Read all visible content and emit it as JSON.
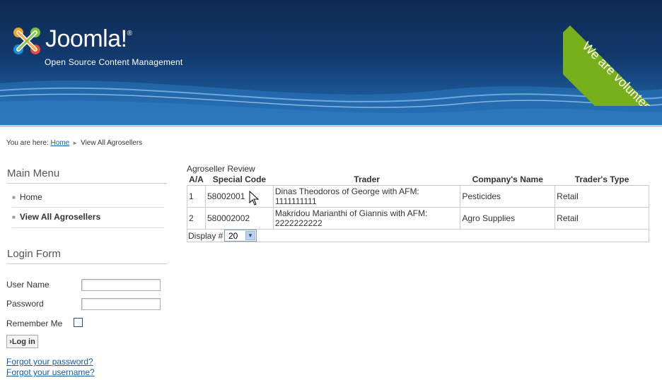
{
  "header": {
    "logo_text": "Joomla!",
    "tagline": "Open Source Content Management",
    "ribbon_text": "We are volunteers !"
  },
  "breadcrumb": {
    "prefix": "You are here:",
    "home": "Home",
    "current": "View All Agrosellers"
  },
  "main_menu": {
    "title": "Main Menu",
    "items": [
      {
        "label": "Home"
      },
      {
        "label": "View All Agrosellers"
      }
    ]
  },
  "login_form": {
    "title": "Login Form",
    "username_label": "User Name",
    "password_label": "Password",
    "remember_label": "Remember Me",
    "login_button": "›Log in",
    "forgot_password": "Forgot your password?",
    "forgot_username": "Forgot your username?"
  },
  "review": {
    "title": "Agroseller Review",
    "columns": [
      "A/A",
      "Special Code",
      "Trader",
      "Company's Name",
      "Trader's Type"
    ],
    "rows": [
      {
        "aa": "1",
        "code": "58002001",
        "trader": "Dinas Theodoros of George with AFM: 1111111111",
        "company": "Pesticides",
        "type": "Retail"
      },
      {
        "aa": "2",
        "code": "580002002",
        "trader": "Makridou Marianthi of Giannis with AFM: 2222222222",
        "company": "Agro Supplies",
        "type": "Retail"
      }
    ],
    "display_label": "Display #",
    "display_value": "20"
  },
  "colors": {
    "link": "#135cae",
    "ribbon": "#77b01a",
    "header_dark": "#0f2a52"
  }
}
